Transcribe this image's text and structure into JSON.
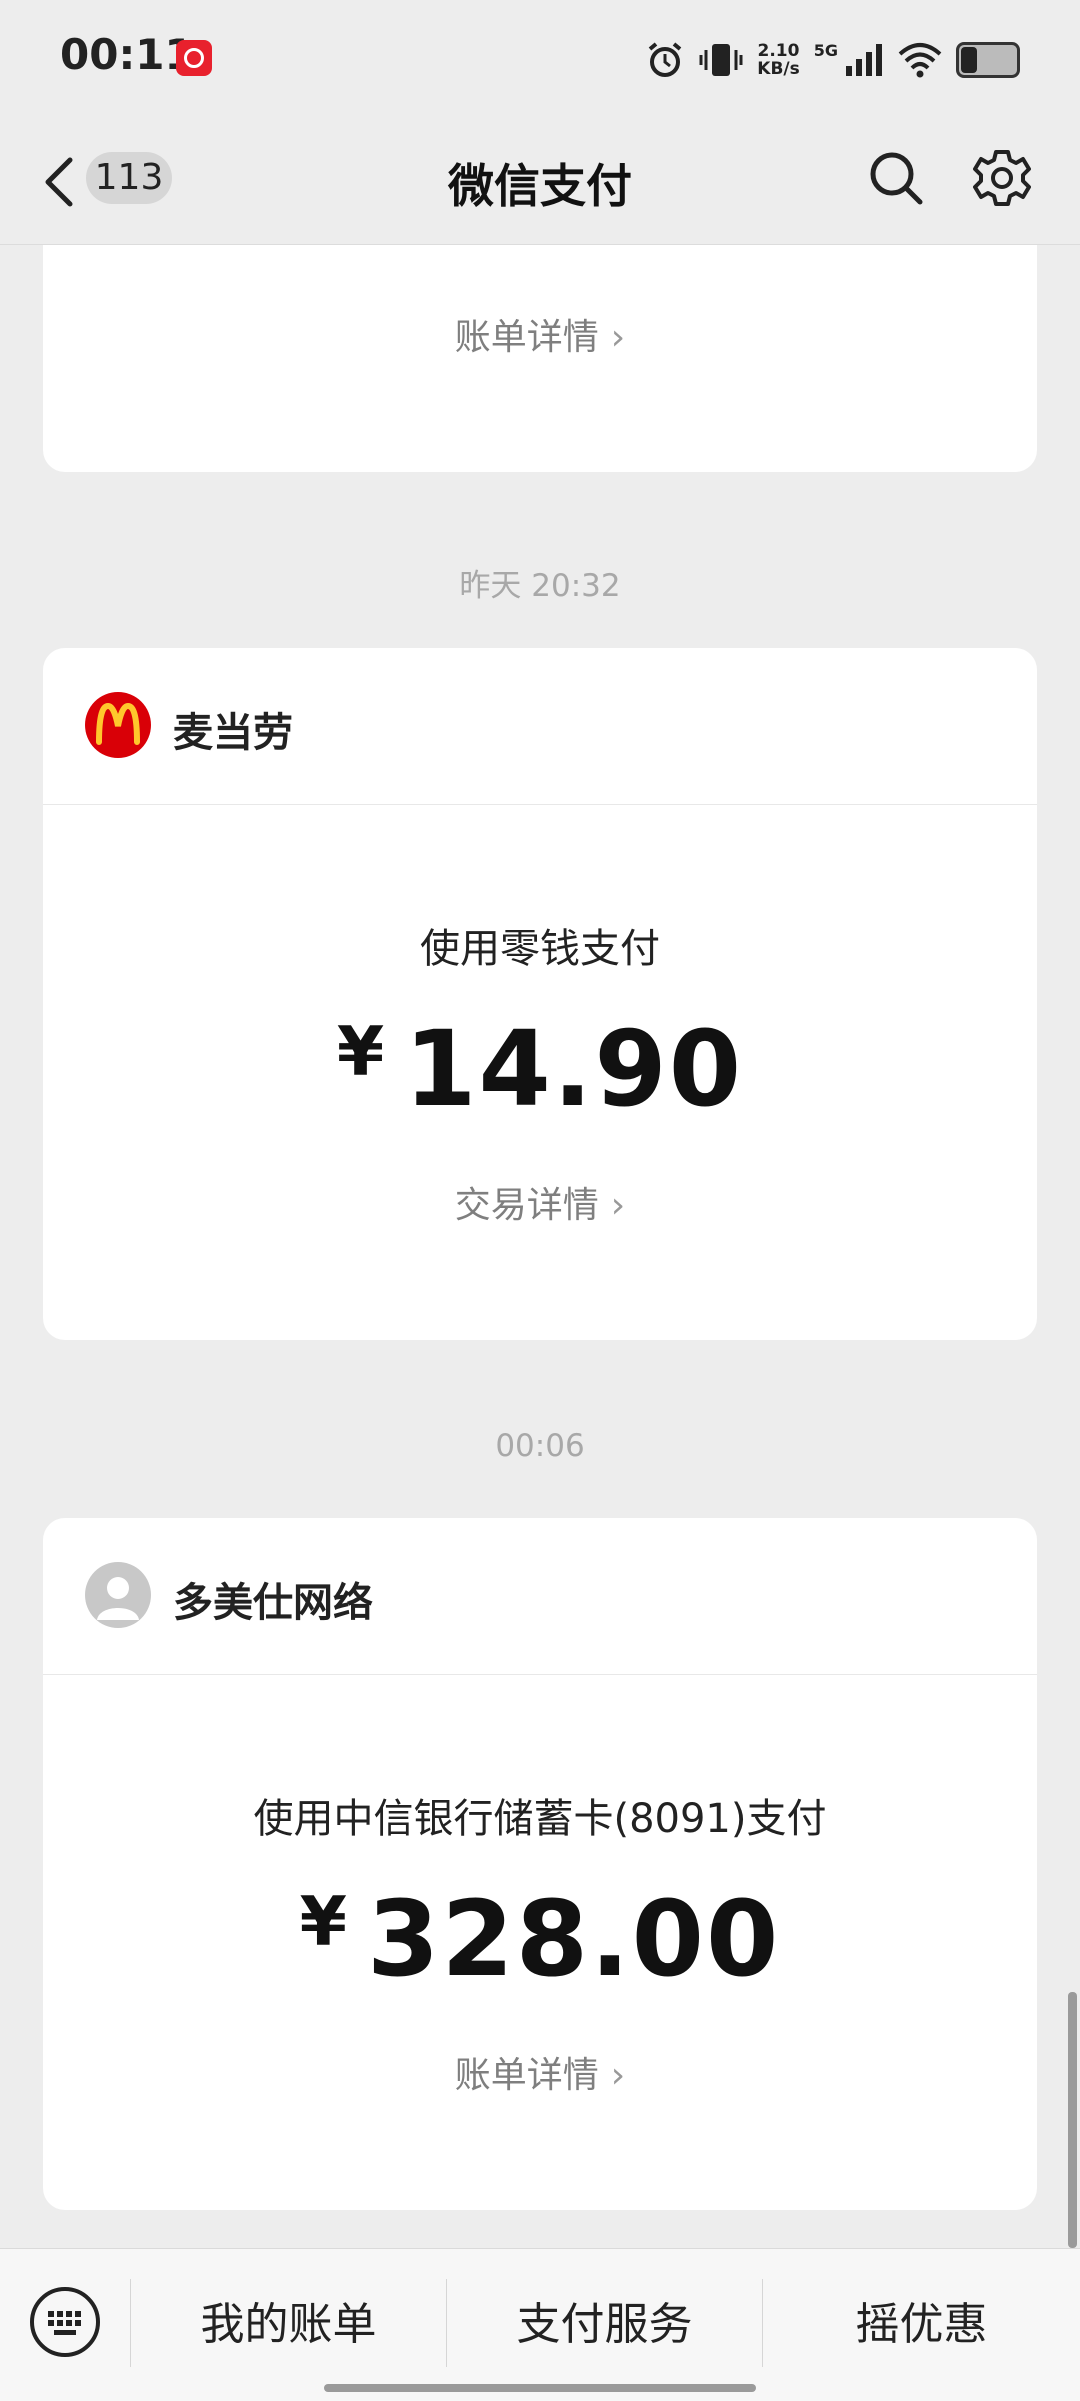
{
  "status_bar": {
    "time": "00:11",
    "net_speed_value": "2.10",
    "net_speed_unit": "KB/s",
    "signal_label": "5G"
  },
  "header": {
    "unread_count": "113",
    "title": "微信支付"
  },
  "cards": [
    {
      "detail_link": "账单详情"
    },
    {
      "merchant": "麦当劳",
      "pay_method": "使用零钱支付",
      "currency": "¥",
      "amount": "14.90",
      "detail_link": "交易详情"
    },
    {
      "merchant": "多美仕网络",
      "pay_method": "使用中信银行储蓄卡(8091)支付",
      "currency": "¥",
      "amount": "328.00",
      "detail_link": "账单详情"
    }
  ],
  "timestamps": [
    "昨天 20:32",
    "00:06"
  ],
  "bottom_bar": {
    "tabs": [
      "我的账单",
      "支付服务",
      "摇优惠"
    ]
  },
  "icons": {
    "music_app": "netease-music-icon",
    "mcd_logo": "mcdonalds-logo",
    "user_avatar": "default-avatar-icon"
  },
  "colors": {
    "mcd_red": "#d90007",
    "mcd_yellow": "#ffc72c",
    "background": "#ededed"
  }
}
